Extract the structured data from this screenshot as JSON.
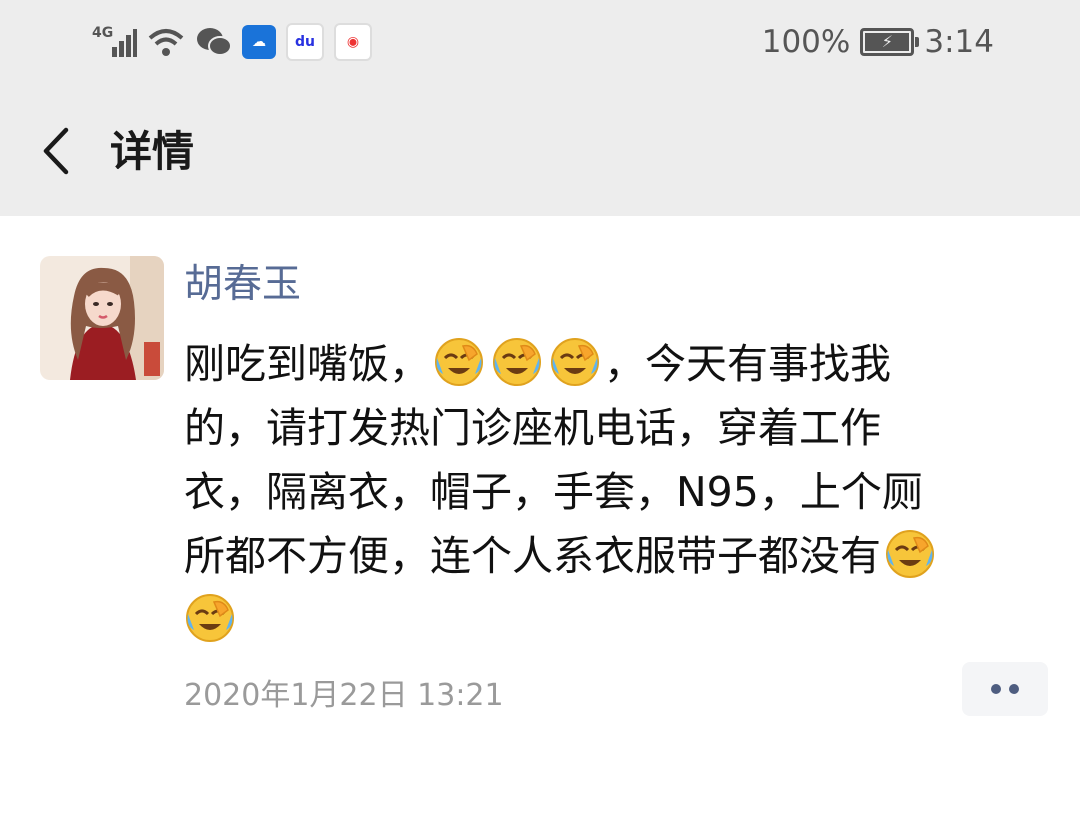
{
  "status_bar": {
    "network": "4G",
    "battery_percent": "100%",
    "time": "3:14",
    "icons": [
      "signal-icon",
      "wifi-icon",
      "wechat-icon",
      "cloud-app-icon",
      "baidu-icon",
      "baidu-maps-icon",
      "battery-charging-icon"
    ]
  },
  "nav": {
    "title": "详情"
  },
  "post": {
    "author": "胡春玉",
    "lines": [
      [
        "刚吃到嘴饭，",
        "",
        "，今天有事找我"
      ],
      [
        "的，请打发热门诊座机电话，穿着工作"
      ],
      [
        "衣，隔离衣，帽子，手套，N95，上个厕"
      ],
      [
        "所都不方便，连个人系衣服带子都没有",
        ""
      ],
      [
        ""
      ]
    ],
    "emoji": "face-with-tears-emoji",
    "timestamp": "2020年1月22日 13:21"
  },
  "colors": {
    "top_bg": "#ededed",
    "link": "#576b95",
    "time": "#9a9a9a"
  }
}
